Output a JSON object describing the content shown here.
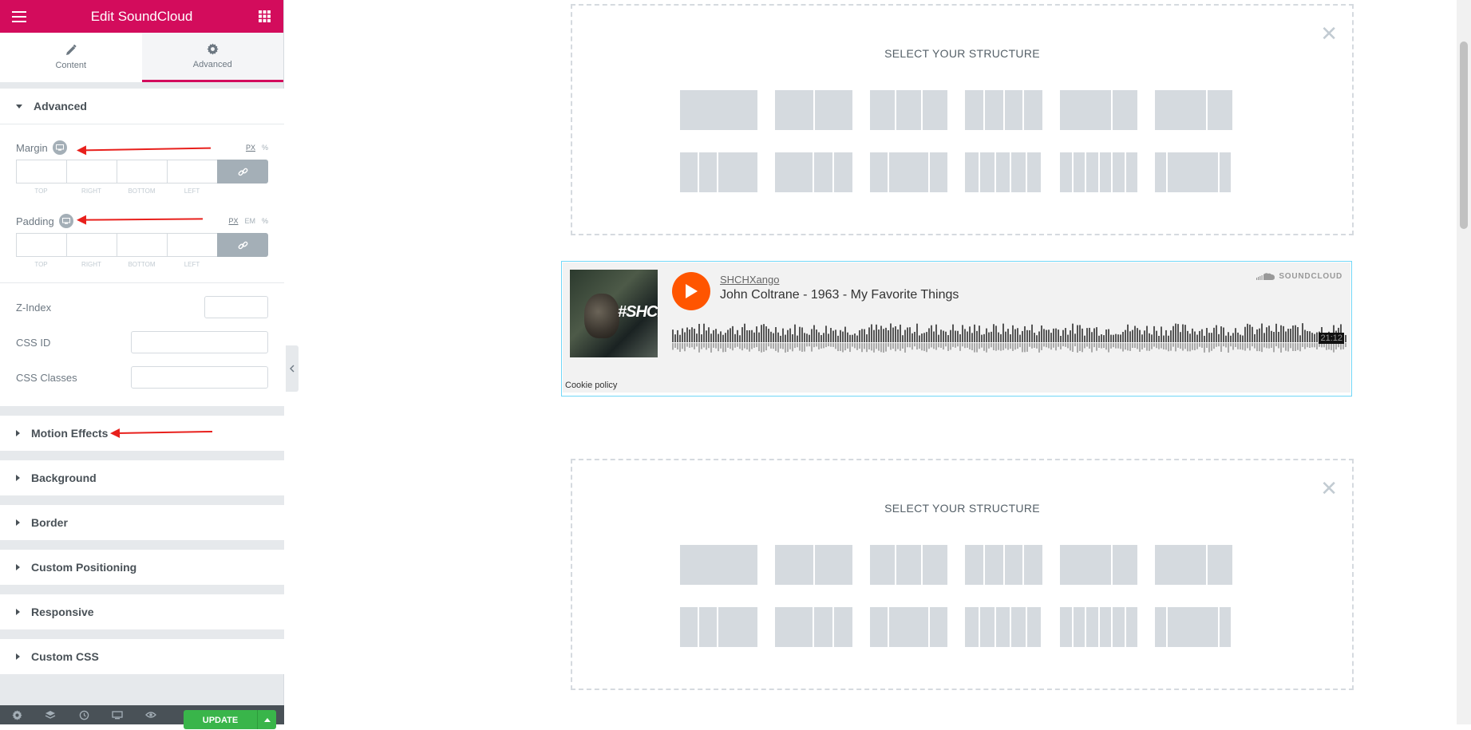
{
  "header": {
    "title": "Edit SoundCloud",
    "menu_icon": "hamburger-icon",
    "apps_icon": "grid-icon"
  },
  "tabs": [
    {
      "label": "Content",
      "icon": "pencil-icon",
      "active": false
    },
    {
      "label": "Advanced",
      "icon": "gear-icon",
      "active": true
    }
  ],
  "advanced": {
    "title": "Advanced",
    "margin": {
      "label": "Margin",
      "units": [
        "PX",
        "%"
      ],
      "active_unit": "PX",
      "sides": [
        "TOP",
        "RIGHT",
        "BOTTOM",
        "LEFT"
      ]
    },
    "padding": {
      "label": "Padding",
      "units": [
        "PX",
        "EM",
        "%"
      ],
      "active_unit": "PX",
      "sides": [
        "TOP",
        "RIGHT",
        "BOTTOM",
        "LEFT"
      ]
    },
    "z_index": {
      "label": "Z-Index",
      "value": ""
    },
    "css_id": {
      "label": "CSS ID",
      "value": ""
    },
    "css_classes": {
      "label": "CSS Classes",
      "value": ""
    }
  },
  "sections": [
    "Motion Effects",
    "Background",
    "Border",
    "Custom Positioning",
    "Responsive",
    "Custom CSS"
  ],
  "footer": {
    "update_label": "UPDATE"
  },
  "canvas": {
    "structure_heading": "SELECT YOUR STRUCTURE",
    "soundcloud": {
      "user": "SHCHXango",
      "track": "John Coltrane - 1963 - My Favorite Things",
      "logo": "SOUNDCLOUD",
      "duration": "21:12",
      "cookie_policy": "Cookie policy",
      "artwork_tag": "#SHCH"
    }
  },
  "colors": {
    "brand": "#d30c5c",
    "update": "#39b54a",
    "sc_orange": "#ff5500",
    "annotation": "#e8201c"
  }
}
